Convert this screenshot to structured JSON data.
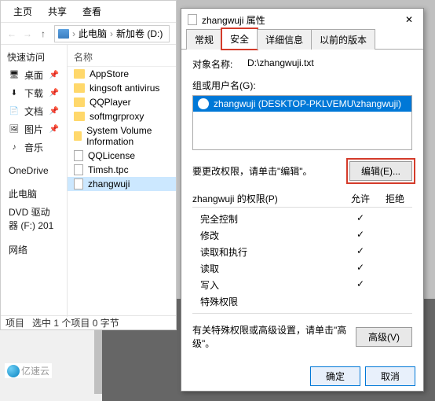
{
  "explorer": {
    "tabs": [
      "主页",
      "共享",
      "查看"
    ],
    "breadcrumb": {
      "pc": "此电脑",
      "drive": "新加卷 (D:)"
    },
    "quick_access": "快速访问",
    "side": [
      {
        "label": "桌面",
        "icon": "🖥"
      },
      {
        "label": "下载",
        "icon": "⬇"
      },
      {
        "label": "文档",
        "icon": "📄"
      },
      {
        "label": "图片",
        "icon": "🖼"
      },
      {
        "label": "音乐",
        "icon": "♪"
      }
    ],
    "groups": [
      "OneDrive",
      "此电脑",
      "DVD 驱动器 (F:) 201",
      "网络"
    ],
    "col_name": "名称",
    "files": [
      {
        "name": "AppStore",
        "type": "folder"
      },
      {
        "name": "kingsoft antivirus",
        "type": "folder"
      },
      {
        "name": "QQPlayer",
        "type": "folder"
      },
      {
        "name": "softmgrproxy",
        "type": "folder"
      },
      {
        "name": "System Volume Information",
        "type": "folder"
      },
      {
        "name": "QQLicense",
        "type": "file"
      },
      {
        "name": "Timsh.tpc",
        "type": "file"
      },
      {
        "name": "zhangwuji",
        "type": "file",
        "sel": true
      }
    ],
    "status_items": "项目",
    "status_sel": "选中 1 个项目 0 字节"
  },
  "props": {
    "title": "zhangwuji 属性",
    "tabs": [
      "常规",
      "安全",
      "详细信息",
      "以前的版本"
    ],
    "object_k": "对象名称:",
    "object_v": "D:\\zhangwuji.txt",
    "groups_k": "组或用户名(G):",
    "user": "zhangwuji (DESKTOP-PKLVEMU\\zhangwuji)",
    "edit_hint": "要更改权限，请单击\"编辑\"。",
    "edit_btn": "编辑(E)...",
    "perm_hdr": "zhangwuji 的权限(P)",
    "allow": "允许",
    "deny": "拒绝",
    "perms": [
      {
        "label": "完全控制",
        "allow": true
      },
      {
        "label": "修改",
        "allow": true
      },
      {
        "label": "读取和执行",
        "allow": true
      },
      {
        "label": "读取",
        "allow": true
      },
      {
        "label": "写入",
        "allow": true
      },
      {
        "label": "特殊权限",
        "allow": false
      }
    ],
    "adv_hint": "有关特殊权限或高级设置，请单击\"高级\"。",
    "adv_btn": "高级(V)",
    "ok": "确定",
    "cancel": "取消"
  },
  "watermark": "亿速云"
}
